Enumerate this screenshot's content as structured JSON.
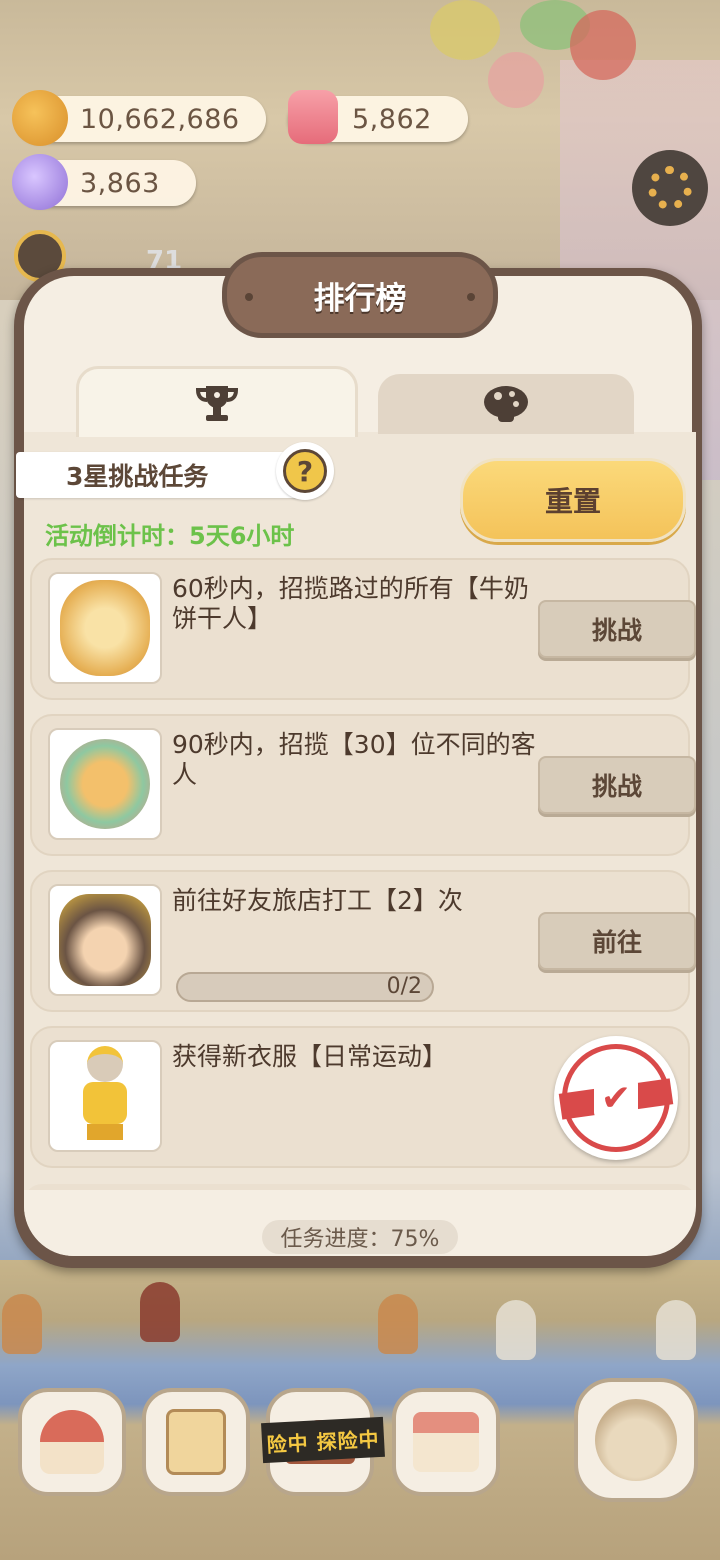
{
  "currencies": {
    "cookies": {
      "value": "10,662,686",
      "icon": "cookie-icon",
      "color": "#e8a23a"
    },
    "jelly": {
      "value": "5,862",
      "icon": "jelly-icon",
      "color": "#ef7b87"
    },
    "crystals": {
      "value": "3,863",
      "icon": "crystal-icon",
      "color": "#a58ce0"
    }
  },
  "background_level": "71",
  "modal": {
    "title": "排行榜",
    "tabs": [
      {
        "icon": "trophy-icon",
        "active": true
      },
      {
        "icon": "mushroom-icon",
        "active": false
      }
    ],
    "section_label": "3星挑战任务",
    "help_symbol": "?",
    "reset_label": "重置",
    "countdown": "活动倒计时：5天6小时",
    "tasks": [
      {
        "description": "60秒内，招揽路过的所有【牛奶饼干人】",
        "action": "挑战",
        "thumb": "milk-cookie-thumb"
      },
      {
        "description": "90秒内，招揽【30】位不同的客人",
        "action": "挑战",
        "thumb": "guests-thumb"
      },
      {
        "description": "前往好友旅店打工【2】次",
        "action": "前往",
        "thumb": "worker-thumb",
        "progress_text": "0/2",
        "progress_value": 0
      },
      {
        "description": "获得新衣服【日常运动】",
        "completed": true,
        "thumb": "outfit-thumb"
      }
    ],
    "footer": "任务进度：75%"
  },
  "bottom_nav": {
    "tape_text": "险中 探险中",
    "items": [
      "home-icon",
      "notebook-icon",
      "explore-icon",
      "shop-icon",
      "character-icon"
    ]
  },
  "colors": {
    "frame": "#6c5548",
    "panel": "#f5eee3",
    "accent_yellow": "#f4c35a",
    "countdown_green": "#6cc24a",
    "stamp_red": "#d94a4a"
  }
}
